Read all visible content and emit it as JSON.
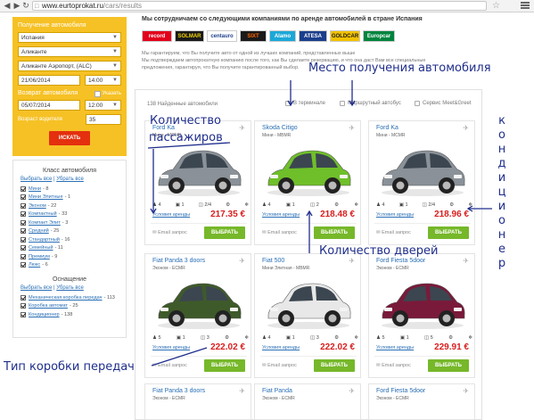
{
  "browser": {
    "url_host": "www.eurtoprokat.ru",
    "url_path": "/cars/results"
  },
  "search": {
    "pickup_label": "Получение автомобиля",
    "country": "Испания",
    "city": "Аликанте",
    "location": "Аликанте Аэропорт, (ALC)",
    "pickup_date": "21/06/2014",
    "pickup_time": "14:00",
    "return_label": "Возврат автомобиля",
    "other_location": "Указать",
    "return_date": "05/07/2014",
    "return_time": "12:00",
    "driver_age_label": "Возраст водителя",
    "driver_age": "35",
    "search_button": "ИСКАТЬ"
  },
  "filters": {
    "class_title": "Класс автомобиля",
    "select_all": "Выбрать все",
    "deselect_all": "Убрать все",
    "classes": [
      {
        "name": "Мини",
        "count": "- 8"
      },
      {
        "name": "Мини Элитные",
        "count": "- 1"
      },
      {
        "name": "Эконом",
        "count": "- 22"
      },
      {
        "name": "Компактный",
        "count": "- 33"
      },
      {
        "name": "Компакт Элит",
        "count": "- 3"
      },
      {
        "name": "Средний",
        "count": "- 25"
      },
      {
        "name": "Стандартный",
        "count": "- 16"
      },
      {
        "name": "Семейный",
        "count": "- 11"
      },
      {
        "name": "Премиум",
        "count": "- 9"
      },
      {
        "name": "Люкс",
        "count": "- 6"
      }
    ],
    "equipment_title": "Оснащение",
    "equipment": [
      {
        "name": "Механическая коробка передач",
        "count": "- 113"
      },
      {
        "name": "Коробка автомат",
        "count": "- 25"
      },
      {
        "name": "Кондиционер",
        "count": "- 138"
      }
    ]
  },
  "partners": {
    "title": "Мы сотрудничаем со следующими компаниями по аренде автомобилей в стране Испания",
    "logos": [
      {
        "name": "record",
        "bg": "#e3001b",
        "color": "#ffffff"
      },
      {
        "name": "SOLMAR",
        "bg": "#1a1a1a",
        "color": "#f2d400"
      },
      {
        "name": "centauro",
        "bg": "#ffffff",
        "color": "#1c3f8c"
      },
      {
        "name": "SIXT",
        "bg": "#1a1a1a",
        "color": "#ff6600"
      },
      {
        "name": "Alamo",
        "bg": "#1ba8d8",
        "color": "#ffffff"
      },
      {
        "name": "ATESA",
        "bg": "#1c3f8c",
        "color": "#ffffff"
      },
      {
        "name": "GOLDCAR",
        "bg": "#f2c200",
        "color": "#1a1a1a"
      },
      {
        "name": "Europcar",
        "bg": "#00843d",
        "color": "#ffffff"
      }
    ],
    "disclaimer_1": "Мы гарантируем, что Вы получите авто от одной из лучших компаний, представленных выше",
    "disclaimer_2": "Мы подтверждаем автопрокатную компанию после того, как Вы сделаете резервацию, и что она даст Вам все специальные",
    "disclaimer_3": "предложения, гарантируя, что Вы получите гарантированный выбор."
  },
  "results": {
    "found": "138 Найденные автомобили",
    "loc_terminal": "В терминале",
    "loc_shuttle": "Маршрутный автобус",
    "loc_meet": "Сервис Meet&Greet"
  },
  "cars": [
    {
      "name": "Ford Ka",
      "class": "Мини - MCMR",
      "seats": "4",
      "bags": "1",
      "doors": "2/4",
      "price": "217.35 €",
      "terms": "Условия аренды",
      "email": "Email запрос",
      "select": "ВЫБРАТЬ",
      "color": "#8a9198"
    },
    {
      "name": "Skoda Citigo",
      "class": "Мини - MBMR",
      "seats": "4",
      "bags": "1",
      "doors": "2",
      "price": "218.48 €",
      "terms": "Условия аренды",
      "email": "Email запрос",
      "select": "ВЫБРАТЬ",
      "color": "#6fbf2a"
    },
    {
      "name": "Ford Ka",
      "class": "Мини - MCMR",
      "seats": "4",
      "bags": "1",
      "doors": "2/4",
      "price": "218.96 €",
      "terms": "Условия аренды",
      "email": "Email запрос",
      "select": "ВЫБРАТЬ",
      "color": "#8a9198"
    },
    {
      "name": "Fiat Panda 3 doors",
      "class": "Эконом - ECMR",
      "seats": "5",
      "bags": "1",
      "doors": "3",
      "price": "222.02 €",
      "terms": "Условия аренды",
      "email": "Email запрос",
      "select": "ВЫБРАТЬ",
      "color": "#3f5a2a"
    },
    {
      "name": "Fiat 500",
      "class": "Мини Элитная - MBMR",
      "seats": "4",
      "bags": "1",
      "doors": "3",
      "price": "222.02 €",
      "terms": "Условия аренды",
      "email": "Email запрос",
      "select": "ВЫБРАТЬ",
      "color": "#e8e8e8"
    },
    {
      "name": "Ford Fiesta 5door",
      "class": "Эконом - ECMR",
      "seats": "5",
      "bags": "1",
      "doors": "5",
      "price": "229.91 €",
      "terms": "Условия аренды",
      "email": "Email запрос",
      "select": "ВЫБРАТЬ",
      "color": "#7a1a3a"
    },
    {
      "name": "Fiat Panda 3 doors",
      "class": "Эконом - ECMR"
    },
    {
      "name": "Fiat Panda",
      "class": "Эконом - ECMR"
    },
    {
      "name": "Ford Fiesta 5door",
      "class": "Эконом - ECMR"
    }
  ],
  "annotations": {
    "pickup_place": "Место получения автомобиля",
    "passengers_1": "Количество",
    "passengers_2": "пассажиров",
    "doors": "Количество дверей",
    "gearbox": "Тип коробки передач",
    "ac_vertical": "кондиционер"
  }
}
